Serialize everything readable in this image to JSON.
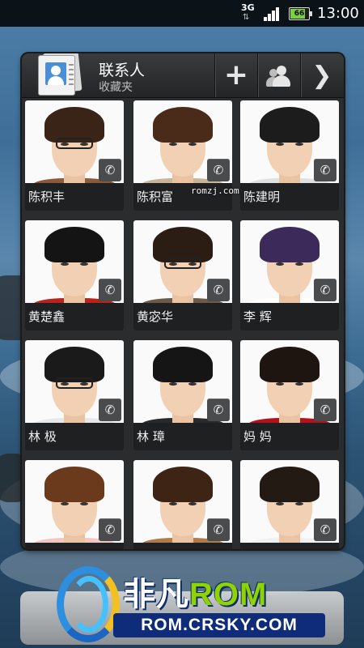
{
  "status_bar": {
    "network": "3G",
    "battery": "66",
    "time": "13:00"
  },
  "widget": {
    "title": "联系人",
    "subtitle": "收藏夹",
    "buttons": [
      {
        "icon": "plus-icon"
      },
      {
        "icon": "group-icon"
      },
      {
        "icon": "chevron-right-icon"
      }
    ]
  },
  "contacts": [
    {
      "name": "陈积丰",
      "hair": "#3a2418",
      "shirt": "#8b5a3c",
      "glasses": true
    },
    {
      "name": "陈积富",
      "hair": "#4a2b1a",
      "shirt": "#c9b49a",
      "glasses": false
    },
    {
      "name": "陈建明",
      "hair": "#1c1c1c",
      "shirt": "#e0e0e0",
      "glasses": false
    },
    {
      "name": "黄楚鑫",
      "hair": "#141414",
      "shirt": "#b8231e",
      "glasses": false
    },
    {
      "name": "黄宓华",
      "hair": "#2b1d14",
      "shirt": "#6b5a4a",
      "glasses": true
    },
    {
      "name": "李 辉",
      "hair": "#3b2a5a",
      "shirt": "#ffffff",
      "glasses": false
    },
    {
      "name": "林 极",
      "hair": "#1a1a1a",
      "shirt": "#e8e8e8",
      "glasses": true
    },
    {
      "name": "林 璋",
      "hair": "#151515",
      "shirt": "#2a2a2a",
      "glasses": false
    },
    {
      "name": "妈 妈",
      "hair": "#1e1410",
      "shirt": "#b3121c",
      "glasses": false
    },
    {
      "name": "",
      "hair": "#6b3a1c",
      "shirt": "#f3c7c0",
      "glasses": false
    },
    {
      "name": "",
      "hair": "#3d2414",
      "shirt": "#b07a4a",
      "glasses": false
    },
    {
      "name": "",
      "hair": "#241a14",
      "shirt": "#f0f0f0",
      "glasses": false
    }
  ],
  "overlay": {
    "small_watermark": "romzj.com",
    "logo_cn": "非凡",
    "logo_rom": "ROM",
    "logo_url": "ROM.CRSKY.COM"
  }
}
